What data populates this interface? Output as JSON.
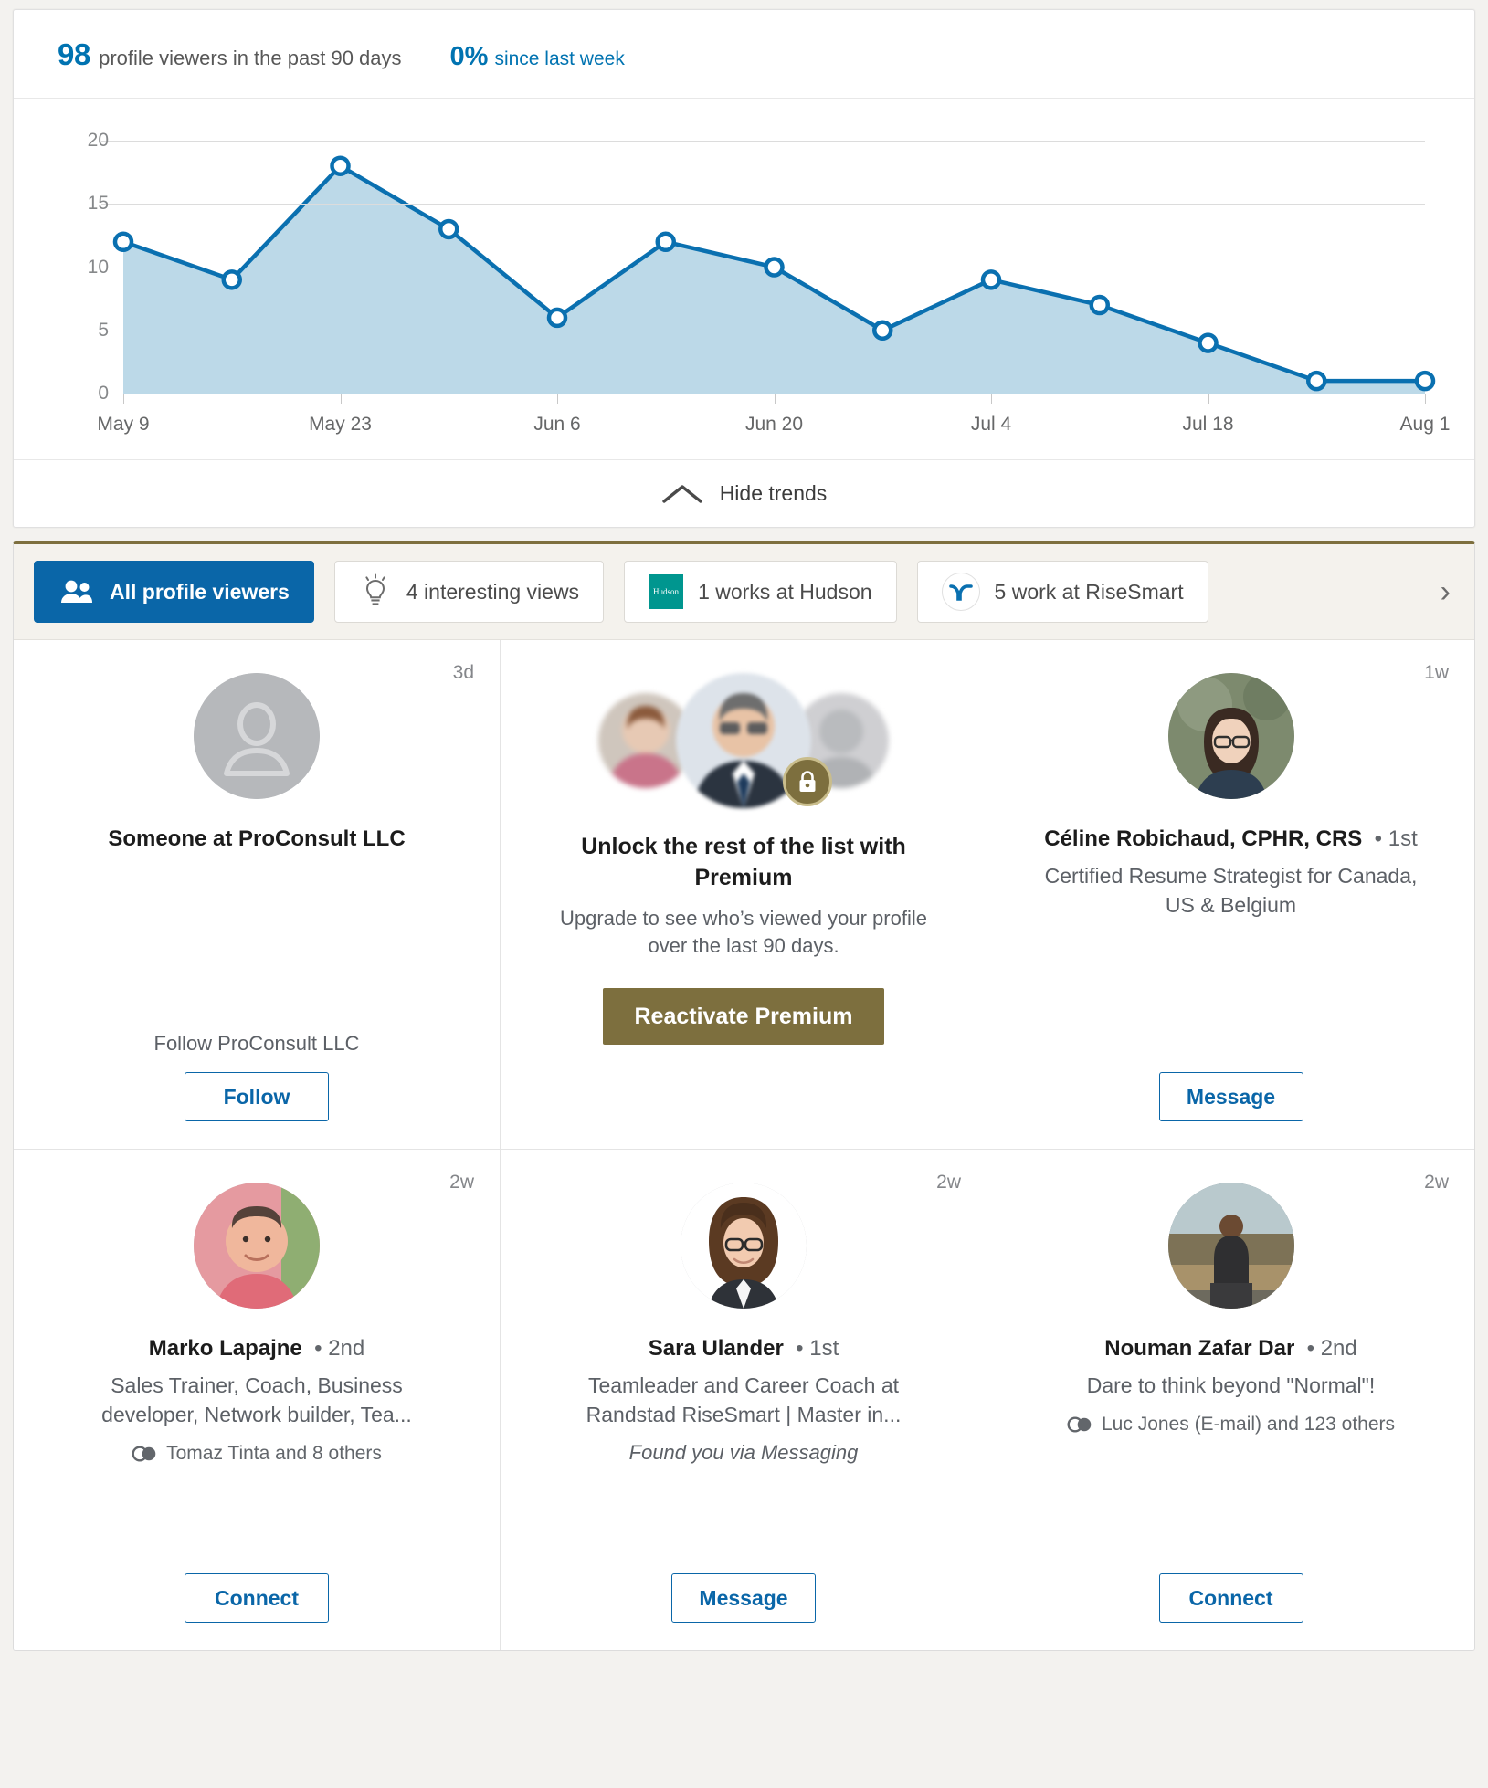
{
  "trends": {
    "count": "98",
    "count_label": "profile viewers in the past 90 days",
    "delta": "0%",
    "delta_label": "since last week",
    "hide_trends_label": "Hide trends",
    "chevron_up_icon": "chevron-up-icon"
  },
  "chart_data": {
    "type": "area",
    "title": "",
    "xlabel": "",
    "ylabel": "",
    "ylim": [
      0,
      20
    ],
    "yticks": [
      "0",
      "5",
      "10",
      "15",
      "20"
    ],
    "grid": true,
    "legend": "none",
    "line_color": "#0a70b0",
    "fill_color": "#bcd9e8",
    "x": [
      "May 9",
      "May 16",
      "May 23",
      "May 30",
      "Jun 6",
      "Jun 13",
      "Jun 20",
      "Jun 27",
      "Jul 4",
      "Jul 11",
      "Jul 18",
      "Jul 25",
      "Aug 1"
    ],
    "xtick_labels": [
      "May 9",
      "May 23",
      "Jun 6",
      "Jun 20",
      "Jul 4",
      "Jul 18",
      "Aug 1"
    ],
    "values": [
      12,
      9,
      18,
      13,
      6,
      12,
      10,
      5,
      9,
      7,
      4,
      1,
      1
    ]
  },
  "filters": {
    "next_arrow_icon": "chevron-right-icon",
    "chips": [
      {
        "label": "All profile viewers",
        "icon": "people-icon",
        "active": true
      },
      {
        "label": "4 interesting views",
        "icon": "lightbulb-icon",
        "active": false
      },
      {
        "label": "1 works at Hudson",
        "icon": "hudson-logo-icon",
        "logo_text": "Hudson",
        "logo_color": "#00968f",
        "active": false
      },
      {
        "label": "5 work at RiseSmart",
        "icon": "risesmart-logo-icon",
        "logo_color": "#0a70b0",
        "active": false
      }
    ]
  },
  "viewers": [
    {
      "type": "anonymous",
      "age": "3d",
      "name": "Someone at ProConsult LLC",
      "avatar_icon": "person-placeholder-icon",
      "follow_text": "Follow ProConsult LLC",
      "action": "Follow"
    },
    {
      "type": "premium_upsell",
      "title": "Unlock the rest of the list with Premium",
      "subtitle": "Upgrade to see who’s viewed your profile over the last 90 days.",
      "action": "Reactivate Premium",
      "lock_icon": "lock-icon"
    },
    {
      "type": "person",
      "age": "1w",
      "name": "Céline Robichaud, CPHR, CRS",
      "degree": "1st",
      "headline": "Certified Resume Strategist for Canada, US & Belgium",
      "action": "Message"
    },
    {
      "type": "person",
      "age": "2w",
      "name": "Marko Lapajne",
      "degree": "2nd",
      "headline": "Sales Trainer, Coach, Business developer, Network builder, Tea...",
      "mutual": "Tomaz Tinta and 8 others",
      "mutual_icon": "mutual-connections-icon",
      "action": "Connect"
    },
    {
      "type": "person",
      "age": "2w",
      "name": "Sara Ulander",
      "degree": "1st",
      "headline": "Teamleader and Career Coach at Randstad RiseSmart | Master in...",
      "found_via": "Found you via Messaging",
      "action": "Message"
    },
    {
      "type": "person",
      "age": "2w",
      "name": "Nouman Zafar Dar",
      "degree": "2nd",
      "headline": "Dare to think beyond \"Normal\"!",
      "mutual": "Luc Jones (E-mail) and 123 others",
      "mutual_icon": "mutual-connections-icon",
      "action": "Connect"
    }
  ],
  "colors": {
    "accent": "#0a66a8",
    "premium": "#7d6f3e",
    "chart_line": "#0a70b0",
    "chart_fill": "#bcd9e8"
  }
}
